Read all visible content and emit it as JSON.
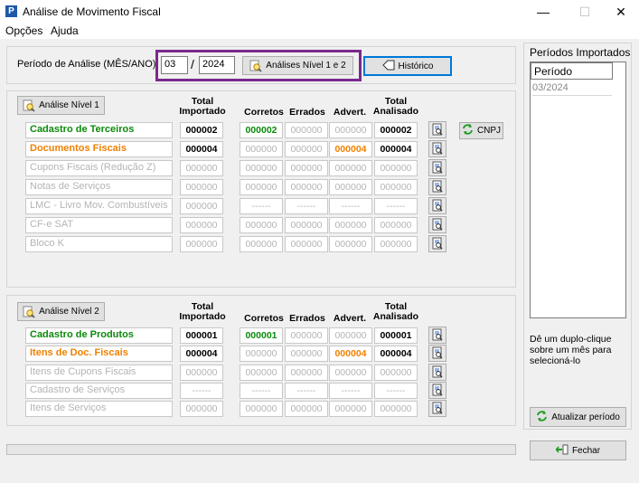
{
  "window": {
    "title": "Análise de Movimento Fiscal",
    "min": "—",
    "max": "☐",
    "close": "✕"
  },
  "menu": [
    {
      "label": "Opções"
    },
    {
      "label": "Ajuda"
    }
  ],
  "period": {
    "label": "Período de Análise (MÊS/ANO):",
    "month": "03",
    "separator": "/",
    "year": "2024",
    "analyses_button": "Análises Nível 1 e 2",
    "history_button": "Histórico"
  },
  "headers": {
    "total_importado": [
      "Total",
      "Importado"
    ],
    "corretos": "Corretos",
    "errados": "Errados",
    "advert": "Advert.",
    "total_analisado": [
      "Total",
      "Analisado"
    ]
  },
  "level1": {
    "button": "Análise Nível 1",
    "rows": [
      {
        "label": "Cadastro de Terceiros",
        "color": "green",
        "importado": "000002",
        "corretos": "000002",
        "errados": "000000",
        "advert": "000000",
        "analisado": "000002",
        "styles": [
          "blk",
          "grn",
          "",
          "",
          "blk"
        ]
      },
      {
        "label": "Documentos Fiscais",
        "color": "orange",
        "importado": "000004",
        "corretos": "000000",
        "errados": "000000",
        "advert": "000004",
        "analisado": "000004",
        "styles": [
          "blk",
          "",
          "",
          "org",
          "blk"
        ]
      },
      {
        "label": "Cupons Fiscais (Redução Z)",
        "color": "gray",
        "importado": "000000",
        "corretos": "000000",
        "errados": "000000",
        "advert": "000000",
        "analisado": "000000",
        "styles": [
          "",
          "",
          "",
          "",
          ""
        ]
      },
      {
        "label": "Notas de Serviços",
        "color": "gray",
        "importado": "000000",
        "corretos": "000000",
        "errados": "000000",
        "advert": "000000",
        "analisado": "000000",
        "styles": [
          "",
          "",
          "",
          "",
          ""
        ]
      },
      {
        "label": "LMC - Livro Mov. Combustíveis",
        "color": "gray",
        "importado": "000000",
        "corretos": "------",
        "errados": "------",
        "advert": "------",
        "analisado": "------",
        "styles": [
          "",
          "",
          "",
          "",
          ""
        ]
      },
      {
        "label": "CF-e SAT",
        "color": "gray",
        "importado": "000000",
        "corretos": "000000",
        "errados": "000000",
        "advert": "000000",
        "analisado": "000000",
        "styles": [
          "",
          "",
          "",
          "",
          ""
        ]
      },
      {
        "label": "Bloco K",
        "color": "gray",
        "importado": "000000",
        "corretos": "000000",
        "errados": "000000",
        "advert": "000000",
        "analisado": "000000",
        "styles": [
          "",
          "",
          "",
          "",
          ""
        ]
      }
    ],
    "cnpj_button": "CNPJ"
  },
  "level2": {
    "button": "Análise Nível 2",
    "rows": [
      {
        "label": "Cadastro de Produtos",
        "color": "green",
        "importado": "000001",
        "corretos": "000001",
        "errados": "000000",
        "advert": "000000",
        "analisado": "000001",
        "styles": [
          "blk",
          "grn",
          "",
          "",
          "blk"
        ]
      },
      {
        "label": "Itens de Doc. Fiscais",
        "color": "orange",
        "importado": "000004",
        "corretos": "000000",
        "errados": "000000",
        "advert": "000004",
        "analisado": "000004",
        "styles": [
          "blk",
          "",
          "",
          "org",
          "blk"
        ]
      },
      {
        "label": "Itens de Cupons Fiscais",
        "color": "gray",
        "importado": "000000",
        "corretos": "000000",
        "errados": "000000",
        "advert": "000000",
        "analisado": "000000",
        "styles": [
          "",
          "",
          "",
          "",
          ""
        ]
      },
      {
        "label": "Cadastro de Serviços",
        "color": "gray",
        "importado": "------",
        "corretos": "------",
        "errados": "------",
        "advert": "------",
        "analisado": "------",
        "styles": [
          "",
          "",
          "",
          "",
          ""
        ]
      },
      {
        "label": "Itens de Serviços",
        "color": "gray",
        "importado": "000000",
        "corretos": "000000",
        "errados": "000000",
        "advert": "000000",
        "analisado": "000000",
        "styles": [
          "",
          "",
          "",
          "",
          ""
        ]
      }
    ]
  },
  "imported_periods": {
    "title": "Períodos Importados",
    "column": "Período",
    "items": [
      "03/2024"
    ],
    "hint": "Dê um duplo-clique sobre um mês para selecioná-lo",
    "update_button": "Atualizar período"
  },
  "close_button": "Fechar",
  "colors": {
    "green": "#0b8a0b",
    "orange": "#f08000",
    "gray": "#b4b4b4",
    "highlight": "#7a2a8c",
    "focus": "#0078d7"
  }
}
